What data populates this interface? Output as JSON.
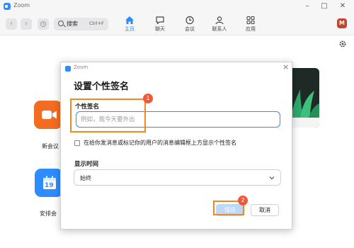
{
  "window": {
    "title": "Zoom"
  },
  "toolbar": {
    "search_label": "搜索",
    "search_shortcut": "Ctrl+F",
    "tabs": [
      {
        "label": "主页",
        "icon": "home-icon",
        "active": true
      },
      {
        "label": "聊天",
        "icon": "chat-icon",
        "active": false
      },
      {
        "label": "会议",
        "icon": "clock-icon",
        "active": false
      },
      {
        "label": "联系人",
        "icon": "contacts-icon",
        "active": false
      },
      {
        "label": "应用",
        "icon": "apps-icon",
        "active": false
      }
    ],
    "avatar_letter": "M"
  },
  "home": {
    "tiles": [
      {
        "label": "新会议",
        "visible_label": "新会议",
        "icon": "video-camera-icon",
        "color": "#f26d21"
      },
      {
        "label": "安排会议",
        "visible_label": "安排会",
        "icon": "calendar-icon",
        "calendar_day": "19",
        "color": "#2d8cff"
      }
    ]
  },
  "dialog": {
    "title": "Zoom",
    "heading": "设置个性签名",
    "signature": {
      "label": "个性签名",
      "placeholder": "例如，我今天要外出",
      "value": ""
    },
    "show_in_chat": {
      "label": "在给你发消息或标记你的用户的消息编辑框上方显示个性签名",
      "checked": false
    },
    "display_time": {
      "label": "显示时间",
      "selected": "始终"
    },
    "buttons": {
      "save": "保存",
      "cancel": "取消"
    }
  },
  "annotations": {
    "markers": [
      "1",
      "2"
    ],
    "color": "#f08a1c",
    "marker_color": "#ef5a3a"
  },
  "colors": {
    "accent": "#2d8cff",
    "new_meeting_orange": "#f26d21",
    "save_button_disabled": "#bcd8fb",
    "avatar": "#c2452d"
  }
}
